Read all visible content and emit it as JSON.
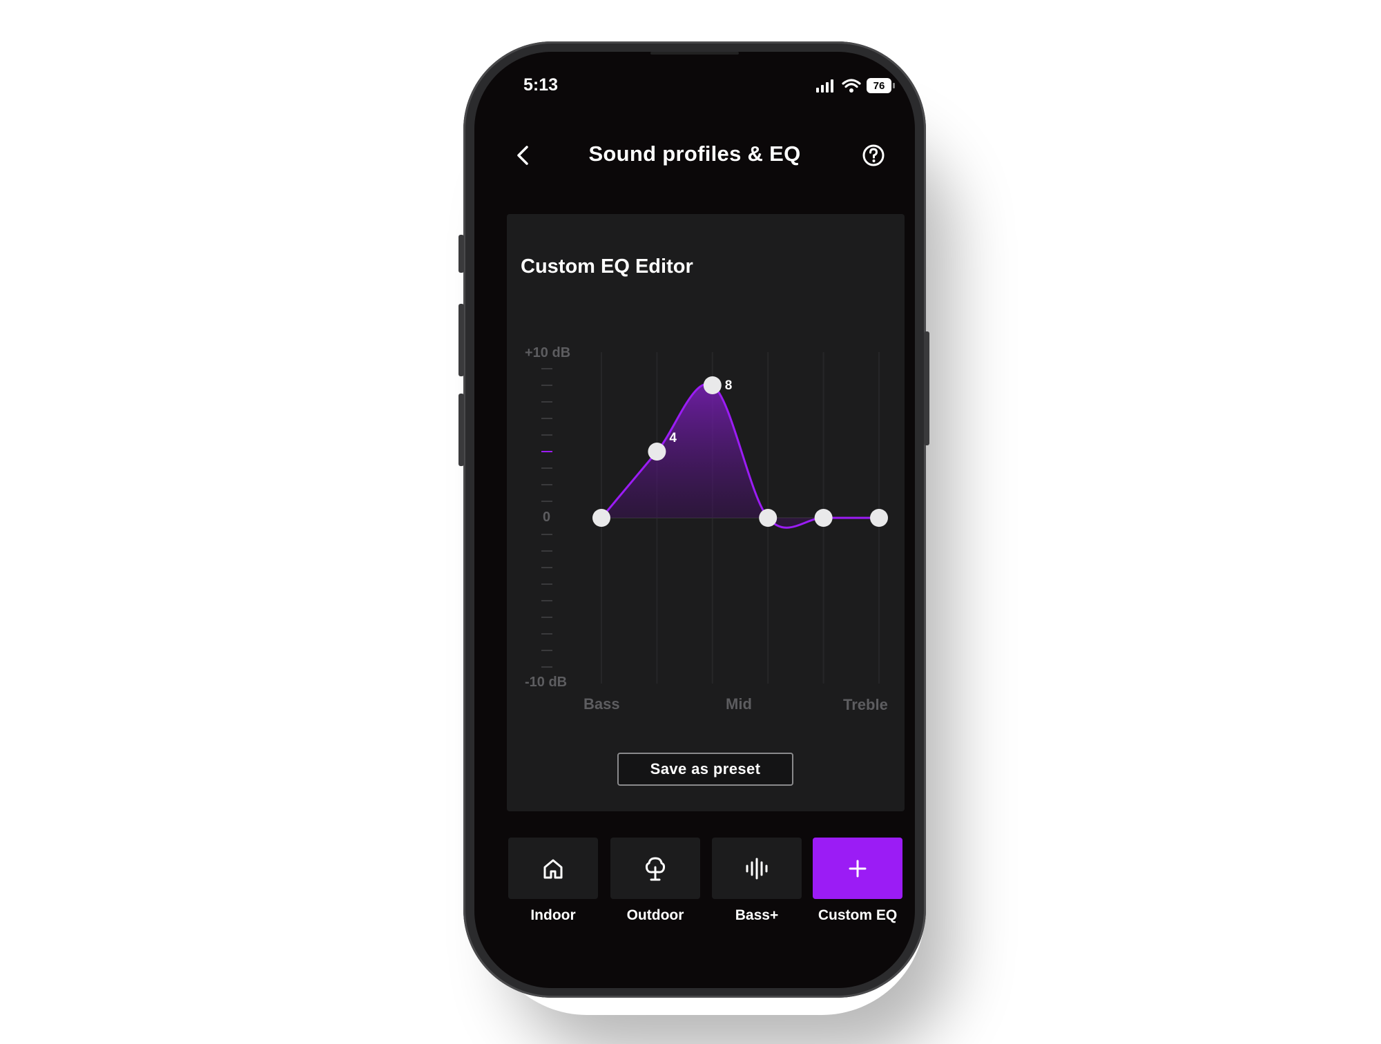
{
  "status_bar": {
    "time": "5:13",
    "battery": "76"
  },
  "header": {
    "title": "Sound profiles & EQ"
  },
  "editor": {
    "title": "Custom EQ Editor",
    "y_top_label": "+10 dB",
    "y_zero_label": "0",
    "y_bottom_label": "-10 dB",
    "band_labels": {
      "bass": "Bass",
      "mid": "Mid",
      "treble": "Treble"
    },
    "save_label": "Save as preset"
  },
  "presets": [
    {
      "label": "Indoor",
      "icon": "home-icon",
      "active": false
    },
    {
      "label": "Outdoor",
      "icon": "tree-icon",
      "active": false
    },
    {
      "label": "Bass+",
      "icon": "waveform-icon",
      "active": false
    },
    {
      "label": "Custom EQ",
      "icon": "plus-icon",
      "active": true
    }
  ],
  "colors": {
    "accent": "#9B1CF5",
    "background": "#0B0809",
    "card": "#1C1C1D"
  },
  "chart_data": {
    "type": "line",
    "ylim": [
      -10,
      10
    ],
    "bands": 6,
    "values": [
      0,
      4,
      8,
      0,
      0,
      0
    ],
    "data_labels": [
      "",
      "4",
      "8",
      "",
      "",
      ""
    ]
  }
}
